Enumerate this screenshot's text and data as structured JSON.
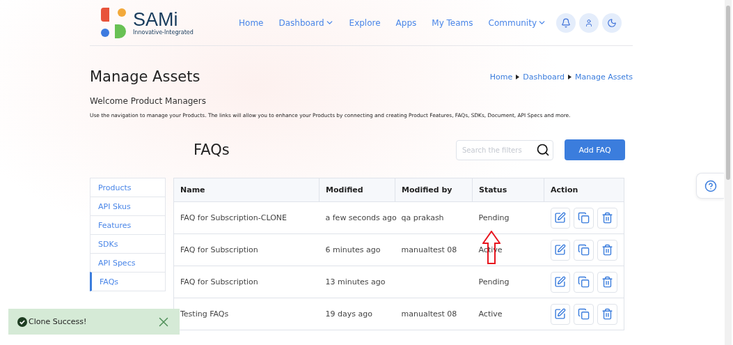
{
  "header": {
    "logo": {
      "name": "SAMi",
      "tagline": "Innovative-Integrated"
    },
    "nav": [
      {
        "label": "Home",
        "dropdown": false
      },
      {
        "label": "Dashboard",
        "dropdown": true
      },
      {
        "label": "Explore",
        "dropdown": false
      },
      {
        "label": "Apps",
        "dropdown": false
      },
      {
        "label": "My Teams",
        "dropdown": false
      },
      {
        "label": "Community",
        "dropdown": true
      }
    ]
  },
  "page": {
    "title": "Manage Assets",
    "breadcrumb": [
      "Home",
      "Dashboard",
      "Manage Assets"
    ],
    "welcome": "Welcome Product Managers",
    "description": "Use the navigation to manage your Products. The links will allow you to enhance your Products by connecting and creating Product Features, FAQs, SDKs, Document, API Specs and more."
  },
  "section": {
    "title": "FAQs",
    "search": {
      "placeholder": "Search the filters"
    },
    "add_button": "Add FAQ"
  },
  "sidebar": {
    "items": [
      {
        "label": "Products",
        "selected": false
      },
      {
        "label": "API Skus",
        "selected": false
      },
      {
        "label": "Features",
        "selected": false
      },
      {
        "label": "SDKs",
        "selected": false
      },
      {
        "label": "API Specs",
        "selected": false
      },
      {
        "label": "FAQs",
        "selected": true
      }
    ]
  },
  "table": {
    "columns": [
      "Name",
      "Modified",
      "Modified by",
      "Status",
      "Action"
    ],
    "rows": [
      {
        "name": "FAQ for Subscription-CLONE",
        "modified": "a few seconds ago",
        "modified_by": "qa prakash",
        "status": "Pending"
      },
      {
        "name": "FAQ for Subscription",
        "modified": "6 minutes ago",
        "modified_by": "manualtest 08",
        "status": "Active"
      },
      {
        "name": "FAQ for Subscription",
        "modified": "13 minutes ago",
        "status": "Pending"
      },
      {
        "name": "Testing FAQs",
        "modified": "19 days ago",
        "modified_by": "manualtest 08",
        "status": "Active"
      }
    ]
  },
  "toast": {
    "message": "Clone Success!"
  }
}
